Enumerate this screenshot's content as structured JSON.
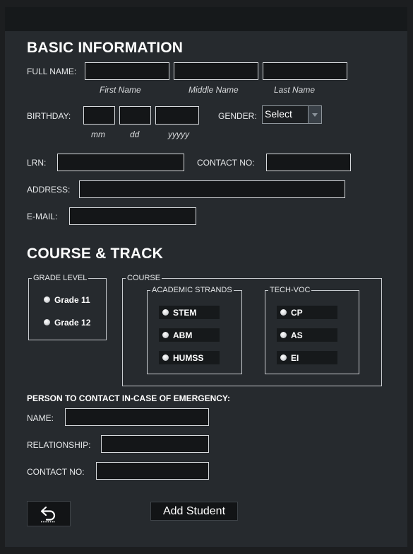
{
  "basic": {
    "heading": "BASIC INFORMATION",
    "full_name_label": "FULL NAME:",
    "first_name_hint": "First Name",
    "middle_name_hint": "Middle Name",
    "last_name_hint": "Last Name",
    "birthday_label": "BIRTHDAY:",
    "mm_hint": "mm",
    "dd_hint": "dd",
    "yyyy_hint": "yyyyy",
    "gender_label": "GENDER:",
    "gender_selected": "Select",
    "lrn_label": "LRN:",
    "contact_label": "CONTACT NO:",
    "address_label": "ADDRESS:",
    "email_label": "E-MAIL:"
  },
  "course_track": {
    "heading": "COURSE & TRACK",
    "grade_level_legend": "GRADE LEVEL",
    "grade_options": [
      "Grade 11",
      "Grade 12"
    ],
    "course_legend": "COURSE",
    "academic_legend": "ACADEMIC STRANDS",
    "academic_options": [
      "STEM",
      "ABM",
      "HUMSS"
    ],
    "techvoc_legend": "TECH-VOC",
    "techvoc_options": [
      "CP",
      "AS",
      "EI"
    ]
  },
  "emergency": {
    "heading": "PERSON TO CONTACT IN-CASE OF EMERGENCY:",
    "name_label": "NAME:",
    "relationship_label": "RELATIONSHIP:",
    "contact_label": "CONTACT NO:"
  },
  "actions": {
    "back_icon": "back-arrow-icon",
    "add_student_label": "Add Student"
  },
  "colors": {
    "background": "#262a2e",
    "titlebar": "#16191b",
    "field": "#141618"
  }
}
